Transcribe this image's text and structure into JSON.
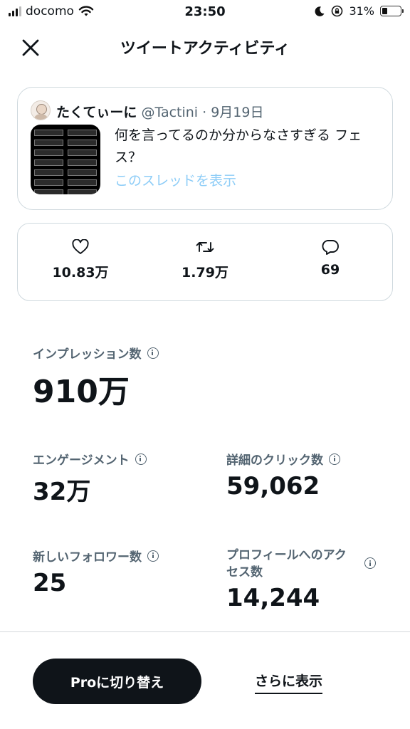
{
  "status_bar": {
    "carrier": "docomo",
    "time": "23:50",
    "battery": "31%"
  },
  "header": {
    "title": "ツイートアクティビティ"
  },
  "tweet": {
    "author_name": "たくてぃーに",
    "author_handle": "@Tactini",
    "separator": " · ",
    "date": "9月19日",
    "text": "何を言ってるのか分からなさすぎる フェス？",
    "thread_link": "このスレッドを表示"
  },
  "metrics": {
    "likes": "10.83万",
    "retweets": "1.79万",
    "replies": "69"
  },
  "stats": {
    "impressions": {
      "label": "インプレッション数",
      "value": "910万"
    },
    "engagements": {
      "label": "エンゲージメント",
      "value": "32万"
    },
    "detail_clicks": {
      "label": "詳細のクリック数",
      "value": "59,062"
    },
    "new_followers": {
      "label": "新しいフォロワー数",
      "value": "25"
    },
    "profile_visits": {
      "label_line1": "プロフィールへのアク",
      "label_line2": "セス数",
      "value": "14,244"
    }
  },
  "footer": {
    "pro_button": "Proに切り替え",
    "more_link": "さらに表示"
  },
  "icons": [
    "wifi-icon",
    "moon-icon",
    "rotation-lock-icon",
    "battery-icon",
    "close-icon",
    "heart-icon",
    "retweet-icon",
    "reply-icon",
    "info-icon"
  ],
  "colors": {
    "text": "#0f1419",
    "secondary": "#536471",
    "link": "#8ecdf7",
    "border": "#cfd9de",
    "button": "#0f1419"
  }
}
